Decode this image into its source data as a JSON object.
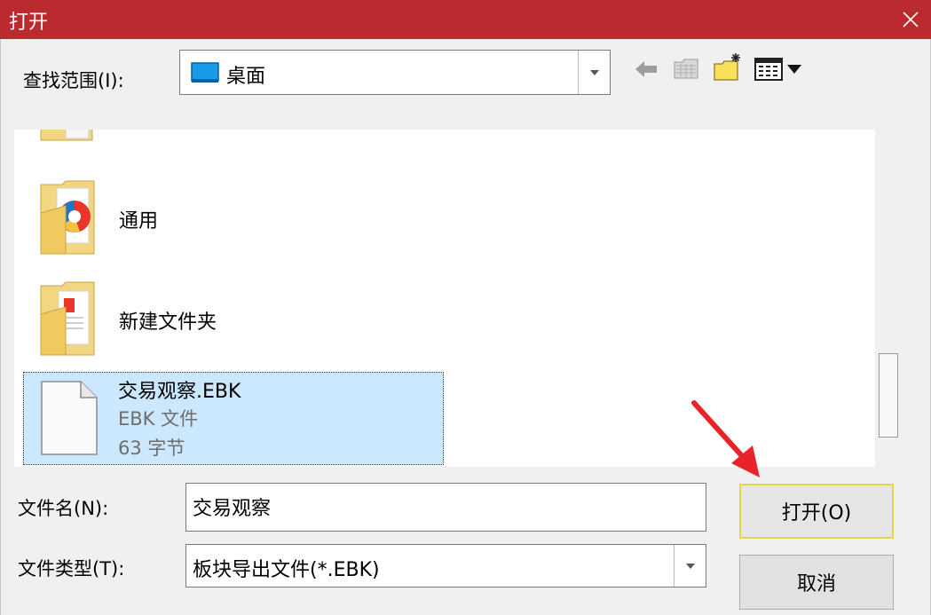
{
  "window": {
    "title": "打开"
  },
  "look_in": {
    "label": "查找范围(I):",
    "value": "桌面"
  },
  "files": [
    {
      "name": "通用",
      "type": "folder"
    },
    {
      "name": "新建文件夹",
      "type": "folder"
    },
    {
      "name": "交易观察.EBK",
      "type_label": "EBK 文件",
      "size": "63 字节",
      "selected": true
    }
  ],
  "filename": {
    "label": "文件名(N):",
    "value": "交易观察"
  },
  "filetype": {
    "label": "文件类型(T):",
    "value": "板块导出文件(*.EBK)"
  },
  "buttons": {
    "open": "打开(O)",
    "cancel": "取消"
  },
  "colors": {
    "titlebar": "#ba2a2e",
    "selection": "#cce8ff",
    "annotation_arrow": "#e8242a"
  },
  "icons": [
    "close-icon",
    "desktop-icon",
    "chevron-down-icon",
    "back-arrow-icon",
    "up-folder-icon",
    "new-folder-icon",
    "view-menu-icon",
    "folder-icon",
    "document-icon"
  ]
}
